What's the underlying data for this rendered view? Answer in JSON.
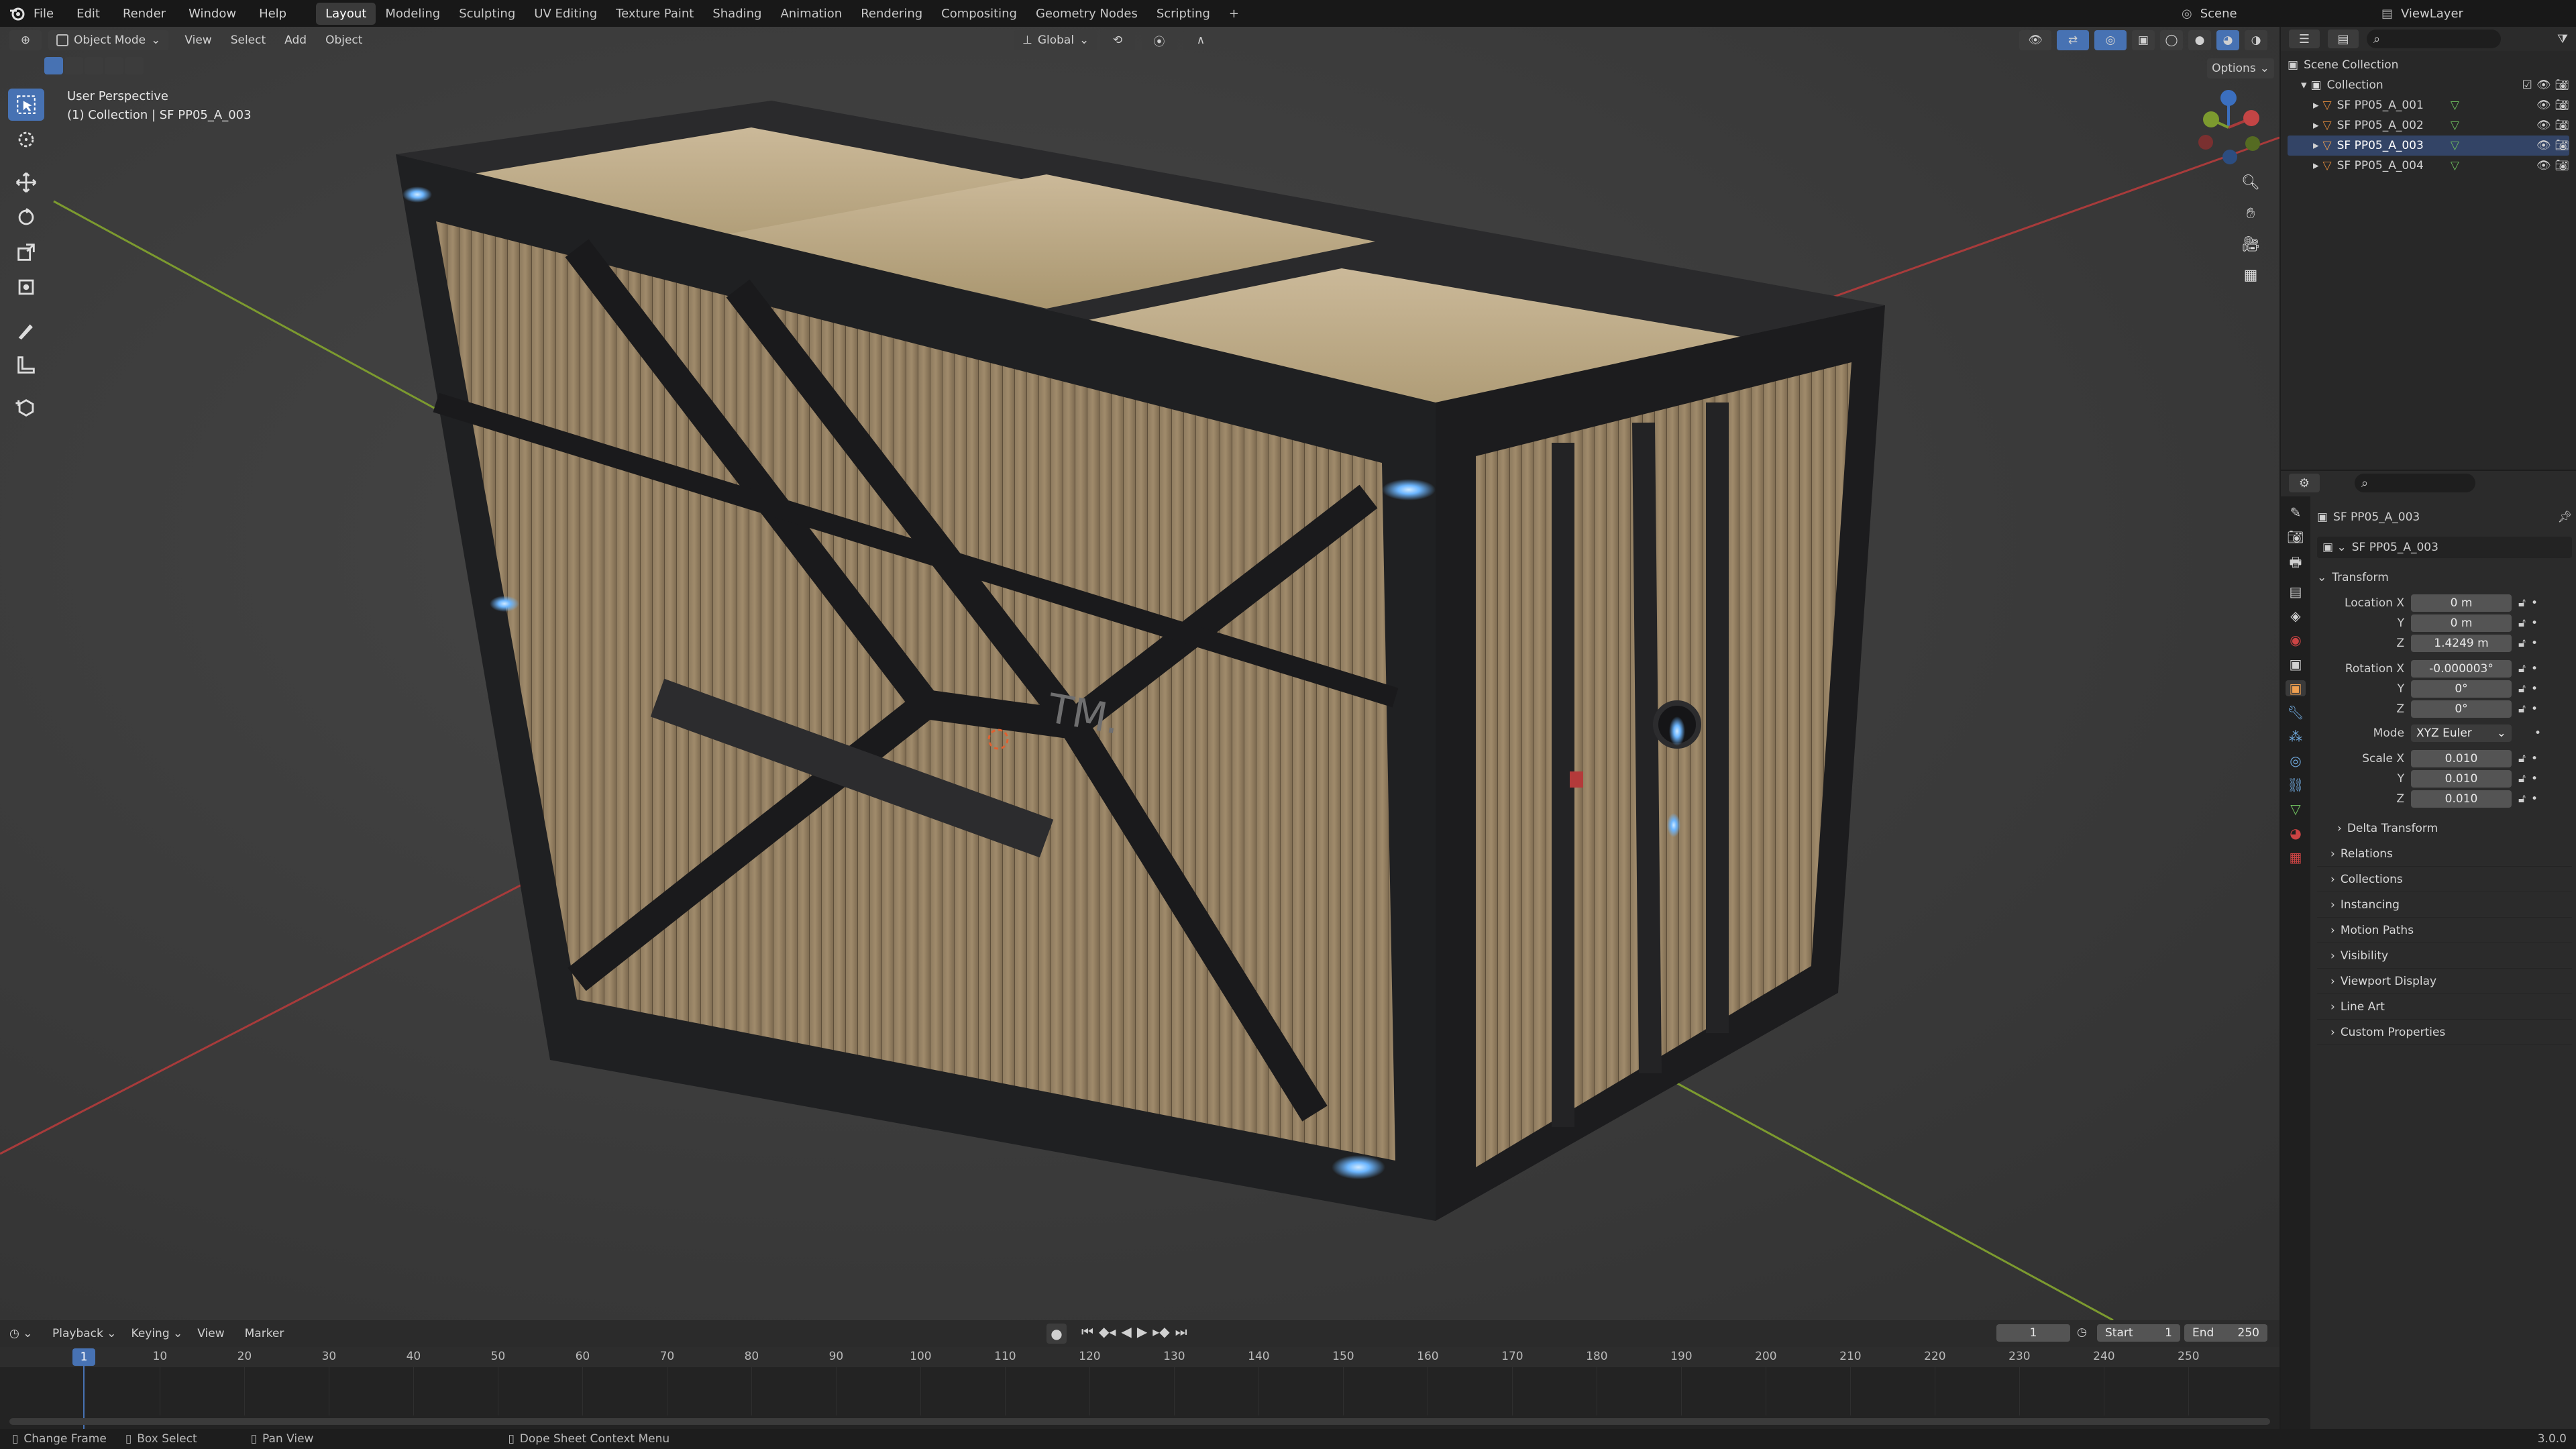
{
  "menus": [
    "File",
    "Edit",
    "Render",
    "Window",
    "Help"
  ],
  "workspaces": [
    "Layout",
    "Modeling",
    "Sculpting",
    "UV Editing",
    "Texture Paint",
    "Shading",
    "Animation",
    "Rendering",
    "Compositing",
    "Geometry Nodes",
    "Scripting"
  ],
  "scene_name": "Scene",
  "view_layer": "ViewLayer",
  "viewport": {
    "mode": "Object Mode",
    "menu": [
      "View",
      "Select",
      "Add",
      "Object"
    ],
    "orientation": "Global",
    "options": "Options",
    "perspective": "User Perspective",
    "collection_info": "(1) Collection | SF PP05_A_003"
  },
  "model_label": "TM.",
  "outliner": {
    "root": "Scene Collection",
    "collection": "Collection",
    "items": [
      "SF PP05_A_001",
      "SF PP05_A_002",
      "SF PP05_A_003",
      "SF PP05_A_004"
    ]
  },
  "properties": {
    "object_name": "SF PP05_A_003",
    "data_name": "SF PP05_A_003",
    "transform_label": "Transform",
    "location_label": "Location X",
    "location": [
      "0 m",
      "0 m",
      "1.4249 m"
    ],
    "rotation_label": "Rotation X",
    "rotation": [
      "-0.000003°",
      "0°",
      "0°"
    ],
    "mode_label": "Mode",
    "mode_value": "XYZ Euler",
    "scale_label": "Scale X",
    "scale": [
      "0.010",
      "0.010",
      "0.010"
    ],
    "axis_y": "Y",
    "axis_z": "Z",
    "panels": [
      "Delta Transform",
      "Relations",
      "Collections",
      "Instancing",
      "Motion Paths",
      "Visibility",
      "Viewport Display",
      "Line Art",
      "Custom Properties"
    ]
  },
  "timeline": {
    "menus": [
      "Playback",
      "Keying",
      "View",
      "Marker"
    ],
    "current_frame": "1",
    "start_label": "Start",
    "start": "1",
    "end_label": "End",
    "end": "250",
    "ticks": [
      "1",
      "10",
      "20",
      "30",
      "40",
      "50",
      "60",
      "70",
      "80",
      "90",
      "100",
      "110",
      "120",
      "130",
      "140",
      "150",
      "160",
      "170",
      "180",
      "190",
      "200",
      "210",
      "220",
      "230",
      "240",
      "250"
    ]
  },
  "status": {
    "change_frame": "Change Frame",
    "box_select": "Box Select",
    "pan_view": "Pan View",
    "context_menu": "Dope Sheet Context Menu",
    "version": "3.0.0"
  },
  "colors": {
    "accent": "#4772b3",
    "x_axis": "#a83b3b",
    "y_axis": "#7c9a2f",
    "z_axis": "#3b6fbf",
    "glow": "#6cb6ff"
  }
}
